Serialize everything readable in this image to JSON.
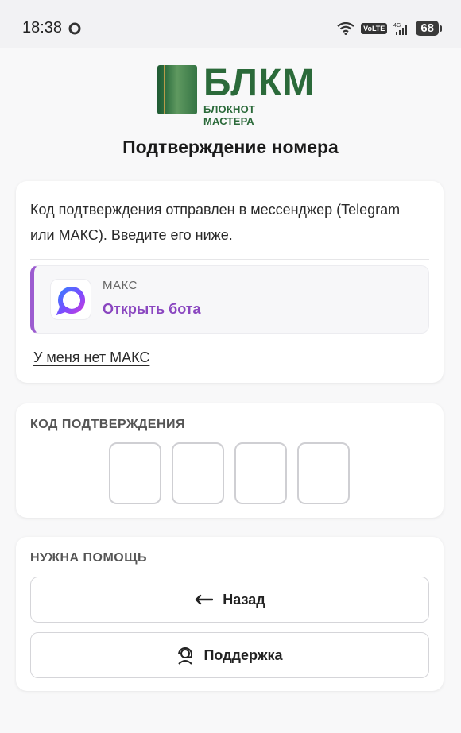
{
  "status_bar": {
    "time": "18:38",
    "network_label": "VoLTE",
    "signal_label": "4G",
    "battery": "68"
  },
  "brand": {
    "title": "БЛКМ",
    "subtitle": "БЛОКНОТ МАСТЕРА"
  },
  "page": {
    "title": "Подтверждение номера"
  },
  "messenger_card": {
    "info_text": "Код подтверждения отправлен в мессенджер (Telegram или МАКС). Введите его ниже.",
    "max_label": "МАКС",
    "open_bot_label": "Открыть бота",
    "no_max_link": "У меня нет МАКС",
    "accent_color": "#9c5cd0"
  },
  "code_card": {
    "label": "КОД ПОДТВЕРЖДЕНИЯ",
    "digits": [
      "",
      "",
      "",
      ""
    ]
  },
  "help_card": {
    "label": "НУЖНА ПОМОЩЬ",
    "back_label": "Назад",
    "support_label": "Поддержка"
  }
}
